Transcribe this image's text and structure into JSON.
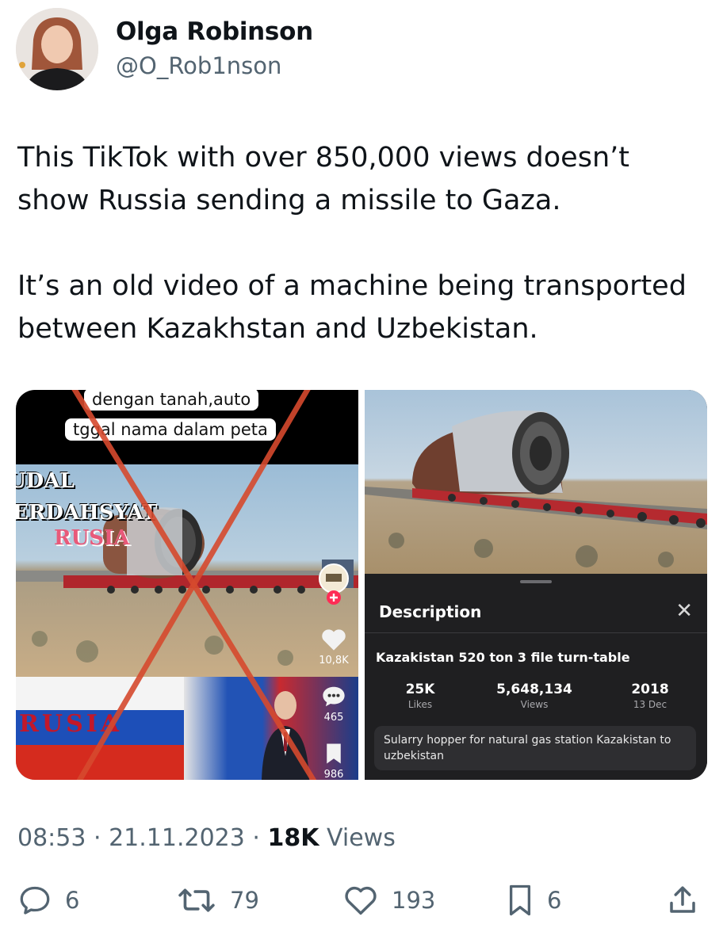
{
  "author": {
    "name": "Olga Robinson",
    "handle": "@O_Rob1nson"
  },
  "tweet": {
    "paragraphs": [
      "This TikTok with over 850,000 views doesn’t show Russia sending a missile to Gaza.",
      "It’s an old video of a machine being transported between Kazakhstan and Uzbekistan."
    ]
  },
  "media_left": {
    "caption_line1": "dengan tanah,auto",
    "caption_line2": "tggal nama dalam peta",
    "overlay_line1": "UDAL",
    "overlay_line2": "ERDAHSYAT",
    "overlay_line3": "RUSIA",
    "flag_text": "RUSIA",
    "likes": "10,8K",
    "comments": "465",
    "saves": "986"
  },
  "media_right": {
    "sheet_title": "Description",
    "video_title": "Kazakistan 520 ton 3 file turn-table",
    "stats": [
      {
        "value": "25K",
        "label": "Likes"
      },
      {
        "value": "5,648,134",
        "label": "Views"
      },
      {
        "value": "2018",
        "label": "13 Dec"
      }
    ],
    "note": "Sularry hopper for natural gas station Kazakistan to uzbekistan"
  },
  "meta": {
    "time": "08:53",
    "date": "21.11.2023",
    "views_count": "18K",
    "views_label": "Views"
  },
  "actions": {
    "replies": "6",
    "reposts": "79",
    "likes": "193",
    "bookmarks": "6"
  },
  "colors": {
    "text": "#0f1419",
    "secondary": "#536471",
    "cross_red": "#d64a2e"
  }
}
